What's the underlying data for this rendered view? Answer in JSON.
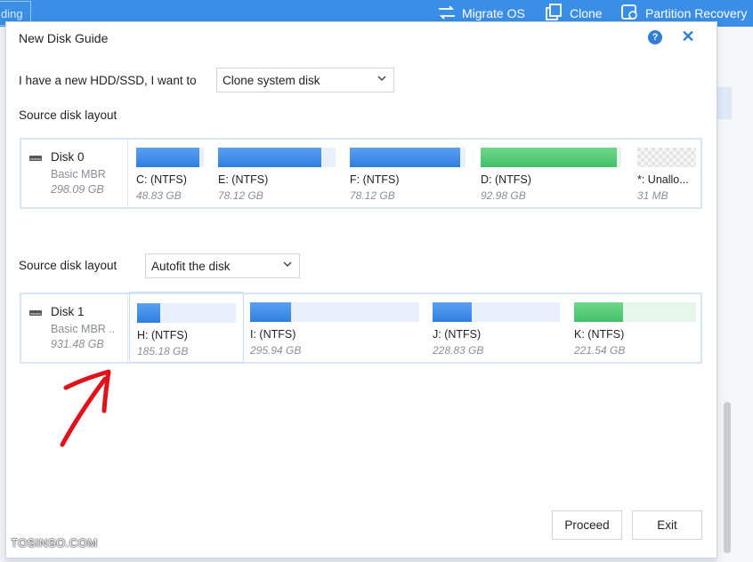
{
  "app": {
    "left_tab_label": "ding",
    "toolbar": [
      {
        "label": "Migrate OS",
        "icon": "migrate-icon"
      },
      {
        "label": "Clone",
        "icon": "clone-icon"
      },
      {
        "label": "Partition Recovery",
        "icon": "partition-recovery-icon"
      }
    ]
  },
  "dialog": {
    "title": "New Disk Guide",
    "help_icon": "?",
    "close_icon": "✕",
    "intent_label": "I have a new HDD/SSD, I want to",
    "intent_select": "Clone system disk",
    "source_label": "Source disk layout",
    "target_label": "Source disk layout",
    "target_select": "Autofit the disk",
    "source_disk": {
      "name": "Disk 0",
      "type": "Basic MBR",
      "size": "298.09 GB",
      "partitions": [
        {
          "label": "C:  (NTFS)",
          "size": "48.83 GB",
          "used": 0.93,
          "color": "blue"
        },
        {
          "label": "E:  (NTFS)",
          "size": "78.12 GB",
          "used": 0.88,
          "color": "blue"
        },
        {
          "label": "F:  (NTFS)",
          "size": "78.12 GB",
          "used": 0.95,
          "color": "blue"
        },
        {
          "label": "D:  (NTFS)",
          "size": "92.98 GB",
          "used": 0.97,
          "color": "green"
        },
        {
          "label": "*: Unallo...",
          "size": "31 MB",
          "used": 0,
          "color": "unallocated"
        }
      ]
    },
    "target_disk": {
      "name": "Disk 1",
      "type": "Basic MBR ..",
      "size": "931.48 GB",
      "partitions": [
        {
          "label": "H:  (NTFS)",
          "size": "185.18 GB",
          "used": 0.23,
          "color": "blue"
        },
        {
          "label": "I:  (NTFS)",
          "size": "295.94 GB",
          "used": 0.24,
          "color": "blue"
        },
        {
          "label": "J:  (NTFS)",
          "size": "228.83 GB",
          "used": 0.31,
          "color": "blue"
        },
        {
          "label": "K:  (NTFS)",
          "size": "221.54 GB",
          "used": 0.4,
          "color": "green"
        }
      ]
    },
    "buttons": {
      "proceed": "Proceed",
      "exit": "Exit"
    }
  },
  "watermark": "TOSINSO.COM",
  "colors": {
    "accent": "#3a8ee6",
    "partition_blue": "#2f7fe0",
    "partition_green": "#43c06a",
    "annotation": "#e0121a"
  }
}
